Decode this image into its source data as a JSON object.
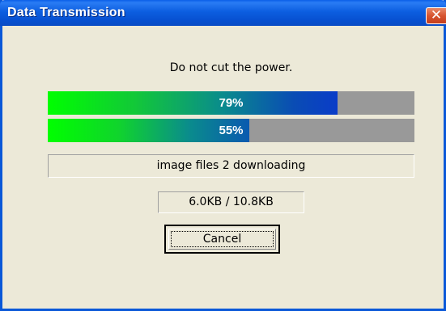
{
  "window": {
    "title": "Data Transmission",
    "close_symbol": "✕",
    "close_icon": "close-icon"
  },
  "message": "Do not cut the power.",
  "progress": [
    {
      "label": "79%",
      "fraction": 0.79
    },
    {
      "label": "55%",
      "fraction": 0.55
    }
  ],
  "status_text": "image files 2 downloading",
  "size_text": "6.0KB / 10.8KB",
  "cancel_label": "Cancel",
  "colors": {
    "titlebar": "#0a5ee8",
    "progress_track": "#999999",
    "progress_start": "#00ff00",
    "progress_end": "#0a3cc8",
    "close_button": "#d75430"
  }
}
